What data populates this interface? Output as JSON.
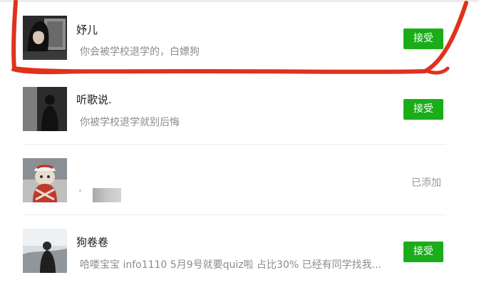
{
  "colors": {
    "accept_button": "#1aad19",
    "annotation_circle": "#e0321c",
    "name_text": "#1a1a1a",
    "message_text": "#8c8c8c",
    "status_text": "#9a9a9a"
  },
  "requests": [
    {
      "name": "妤儿",
      "message": "你会被学校退学的，白嫖狗",
      "action": "接受"
    },
    {
      "name": "听歌说.",
      "message": "你被学校退学就别后悔",
      "action": "接受"
    },
    {
      "name": "",
      "message": "",
      "status": "已添加"
    },
    {
      "name": "狗卷卷",
      "message": "哈喽宝宝  info1110 5月9号就要quiz啦 占比30% 已经有同学找我...",
      "action": "接受"
    }
  ]
}
